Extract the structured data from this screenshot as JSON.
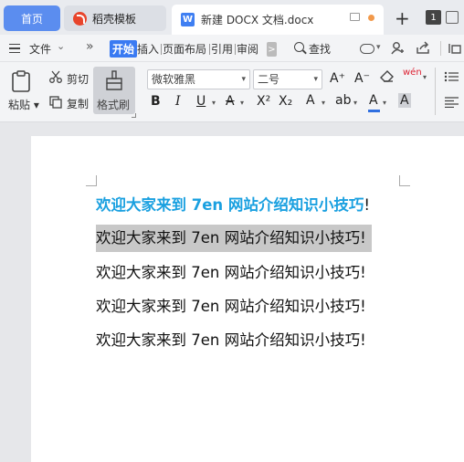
{
  "tabs": {
    "home": "首页",
    "daoke": "稻壳模板",
    "doc": "新建 DOCX 文档.docx",
    "doc_icon_letter": "W",
    "add": "+",
    "count": "1"
  },
  "menu": {
    "file": "文件",
    "start": "开始",
    "insert": "插入",
    "layout": "页面布局",
    "reference": "引用",
    "review": "审阅",
    "scroll": ">",
    "search": "查找"
  },
  "ribbon": {
    "paste": "粘贴",
    "cut": "剪切",
    "copy": "复制",
    "format_painter": "格式刷",
    "font_name": "微软雅黑",
    "font_size": "二号",
    "grow": "A⁺",
    "shrink": "A⁻",
    "pinyin": "wén",
    "bold": "B",
    "italic": "I",
    "underline": "U",
    "strike": "A",
    "superscript": "X²",
    "subscript": "X₂",
    "effect": "A",
    "highlight": "ab",
    "font_color": "A",
    "shading": "A"
  },
  "document": {
    "lines": [
      {
        "main": "欢迎大家来到 7en 网站介绍知识小技巧",
        "end": "!"
      },
      {
        "text": "欢迎大家来到 7en 网站介绍知识小技巧!"
      },
      {
        "text": "欢迎大家来到 7en 网站介绍知识小技巧!"
      },
      {
        "text": "欢迎大家来到 7en 网站介绍知识小技巧!"
      },
      {
        "text": "欢迎大家来到 7en 网站介绍知识小技巧!"
      }
    ]
  },
  "colors": {
    "accent": "#3a7af2",
    "title_text": "#1aa0e0",
    "selection": "#c8c8c8"
  },
  "icons": [
    "daoke-logo-icon",
    "word-doc-icon",
    "monitor-icon",
    "hamburger-icon",
    "search-icon",
    "cloud-icon",
    "add-user-icon",
    "share-icon",
    "paste-icon",
    "scissors-icon",
    "copy-icon",
    "format-painter-icon",
    "eraser-icon",
    "list-icon"
  ]
}
